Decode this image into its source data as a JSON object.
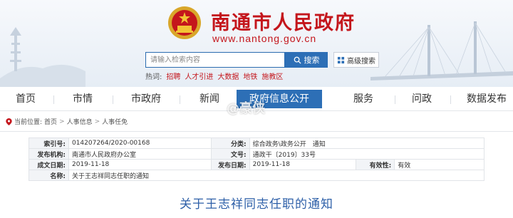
{
  "header": {
    "site_title": "南通市人民政府",
    "site_domain": "www.nantong.gov.cn",
    "emblem_icon": "national-emblem-icon"
  },
  "search": {
    "placeholder": "请输入检索内容",
    "button_label": "搜索",
    "advanced_label": "高级搜索"
  },
  "hot_words": {
    "label": "热词:",
    "items": [
      "招聘",
      "人才引进",
      "大数据",
      "地铁",
      "施教区"
    ]
  },
  "nav": {
    "items": [
      "首页",
      "市情",
      "市政府",
      "新闻",
      "政府信息公开",
      "服务",
      "问政",
      "数据发布"
    ],
    "active": "政府信息公开",
    "active_color": "#2d6fb6"
  },
  "breadcrumb": {
    "label": "当前位置:",
    "items": [
      "首页",
      "人事信息",
      "人事任免"
    ]
  },
  "info": {
    "index_no_label": "索引号:",
    "index_no": "014207264/2020-00168",
    "category_label": "分类:",
    "category": "综合政务\\政务公开　通知",
    "publisher_label": "发布机构:",
    "publisher": "南通市人民政府办公室",
    "doc_no_label": "文号:",
    "doc_no": "通政干〔2019〕33号",
    "created_label": "成文日期:",
    "created": "2019-11-18",
    "published_label": "发布日期:",
    "published": "2019-11-18",
    "validity_label": "有效性:",
    "validity": "有效",
    "name_label": "名称:",
    "name": "关于王志祥同志任职的通知"
  },
  "article": {
    "title": "关于王志祥同志任职的通知"
  },
  "watermark": {
    "text": "@豪侠"
  },
  "colors": {
    "brand_red": "#c4161c",
    "brand_blue": "#2d6fb6",
    "title_blue": "#2d5fa8"
  }
}
